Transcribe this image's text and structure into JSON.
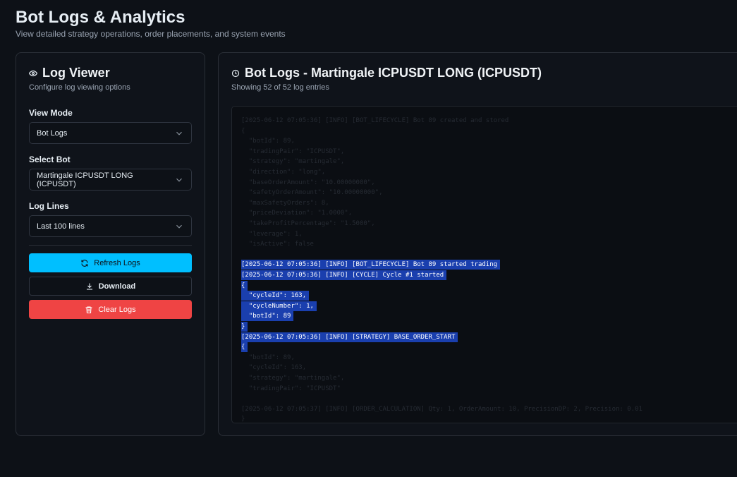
{
  "header": {
    "title": "Bot Logs & Analytics",
    "subtitle": "View detailed strategy operations, order placements, and system events"
  },
  "viewer": {
    "title": "Log Viewer",
    "description": "Configure log viewing options",
    "view_mode_label": "View Mode",
    "view_mode_value": "Bot Logs",
    "select_bot_label": "Select Bot",
    "select_bot_value": "Martingale ICPUSDT LONG (ICPUSDT)",
    "log_lines_label": "Log Lines",
    "log_lines_value": "Last 100 lines",
    "refresh_label": "Refresh Logs",
    "download_label": "Download",
    "clear_label": "Clear Logs"
  },
  "logs": {
    "title": "Bot Logs - Martingale ICPUSDT LONG (ICPUSDT)",
    "count_text": "Showing 52 of 52 log entries",
    "lines": [
      {
        "text": "[2025-06-12 07:05:36] [INFO] [BOT_LIFECYCLE] Bot 89 created and stored",
        "selected": false
      },
      {
        "text": "{",
        "selected": false
      },
      {
        "text": "  \"botId\": 89,",
        "selected": false
      },
      {
        "text": "  \"tradingPair\": \"ICPUSDT\",",
        "selected": false
      },
      {
        "text": "  \"strategy\": \"martingale\",",
        "selected": false
      },
      {
        "text": "  \"direction\": \"long\",",
        "selected": false
      },
      {
        "text": "  \"baseOrderAmount\": \"10.00000000\",",
        "selected": false
      },
      {
        "text": "  \"safetyOrderAmount\": \"10.00000000\",",
        "selected": false
      },
      {
        "text": "  \"maxSafetyOrders\": 8,",
        "selected": false
      },
      {
        "text": "  \"priceDeviation\": \"1.0000\",",
        "selected": false
      },
      {
        "text": "  \"takeProfitPercentage\": \"1.5000\",",
        "selected": false
      },
      {
        "text": "  \"leverage\": 1,",
        "selected": false
      },
      {
        "text": "  \"isActive\": false",
        "selected": false
      },
      {
        "text": "",
        "selected": false
      },
      {
        "text": "[2025-06-12 07:05:36] [INFO] [BOT_LIFECYCLE] Bot 89 started trading",
        "selected": true
      },
      {
        "text": "[2025-06-12 07:05:36] [INFO] [CYCLE] Cycle #1 started",
        "selected": true
      },
      {
        "text": "{",
        "selected": true
      },
      {
        "text": "  \"cycleId\": 163,",
        "selected": true
      },
      {
        "text": "  \"cycleNumber\": 1,",
        "selected": true
      },
      {
        "text": "  \"botId\": 89",
        "selected": true
      },
      {
        "text": "}",
        "selected": true
      },
      {
        "text": "[2025-06-12 07:05:36] [INFO] [STRATEGY] BASE_ORDER_START",
        "selected": true
      },
      {
        "text": "{",
        "selected": true
      },
      {
        "text": "  \"botId\": 89,",
        "selected": false
      },
      {
        "text": "  \"cycleId\": 163,",
        "selected": false
      },
      {
        "text": "  \"strategy\": \"martingale\",",
        "selected": false
      },
      {
        "text": "  \"tradingPair\": \"ICPUSDT\"",
        "selected": false
      },
      {
        "text": "",
        "selected": false
      },
      {
        "text": "[2025-06-12 07:05:37] [INFO] [ORDER_CALCULATION] Qty: 1, OrderAmount: 10, PrecisionDP: 2, Precision: 0.01",
        "selected": false
      },
      {
        "text": "}",
        "selected": false
      }
    ]
  },
  "colors": {
    "background": "#0d1117",
    "refresh_button": "#00bfff",
    "clear_button": "#ef4444",
    "selection": "#1a3fae"
  },
  "icons": {
    "viewer": "eye-icon",
    "logs": "clock-icon",
    "refresh": "refresh-icon",
    "download": "download-icon",
    "clear": "trash-icon",
    "select": "chevron-down-icon"
  }
}
